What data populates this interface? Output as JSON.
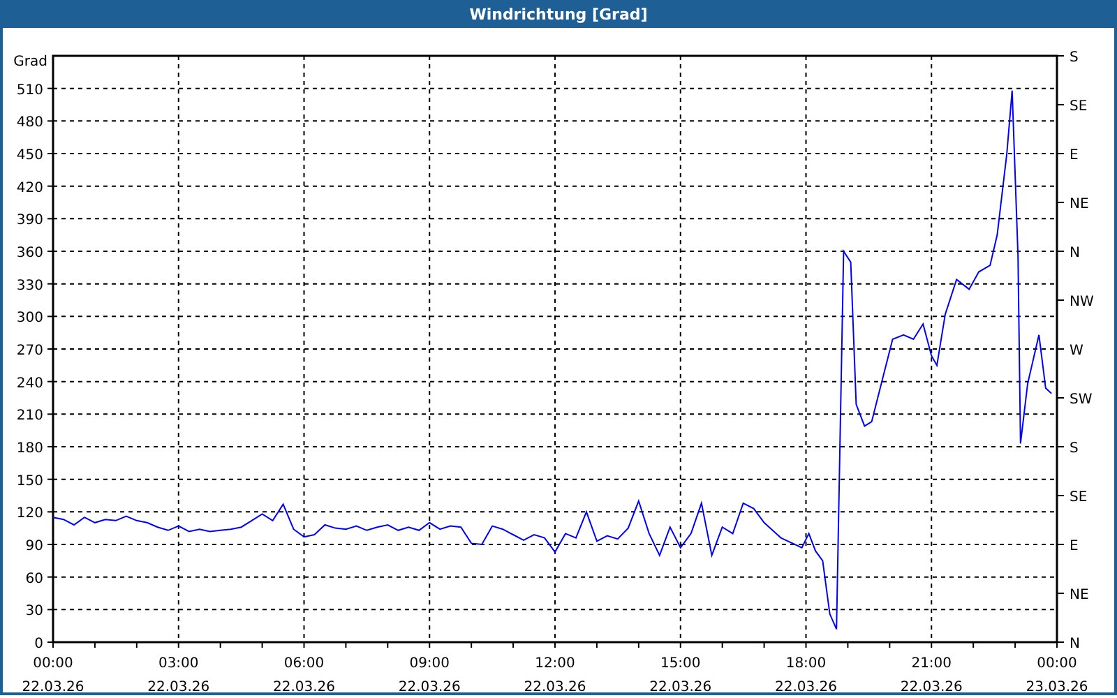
{
  "window": {
    "title": "Windrichtung [Grad]"
  },
  "chart": {
    "chart_data": {
      "type": "line",
      "grid": true,
      "ylabel": "Grad",
      "xlim": [
        0,
        24
      ],
      "ylim": [
        0,
        540
      ],
      "xticks": [
        {
          "value": 0,
          "label": "00:00"
        },
        {
          "value": 3,
          "label": "03:00"
        },
        {
          "value": 6,
          "label": "06:00"
        },
        {
          "value": 9,
          "label": "09:00"
        },
        {
          "value": 12,
          "label": "12:00"
        },
        {
          "value": 15,
          "label": "15:00"
        },
        {
          "value": 18,
          "label": "18:00"
        },
        {
          "value": 21,
          "label": "21:00"
        },
        {
          "value": 24,
          "label": "00:00"
        }
      ],
      "yticks": [
        0,
        30,
        60,
        90,
        120,
        150,
        180,
        210,
        240,
        270,
        300,
        330,
        360,
        390,
        420,
        450,
        480,
        510
      ],
      "x": [
        0,
        0.25,
        0.5,
        0.75,
        1,
        1.25,
        1.5,
        1.75,
        2,
        2.25,
        2.5,
        2.75,
        3,
        3.25,
        3.5,
        3.75,
        4,
        4.25,
        4.5,
        4.75,
        5,
        5.25,
        5.5,
        5.75,
        6,
        6.25,
        6.5,
        6.75,
        7,
        7.25,
        7.5,
        7.75,
        8,
        8.25,
        8.5,
        8.75,
        9,
        9.25,
        9.5,
        9.75,
        10,
        10.25,
        10.5,
        10.75,
        11,
        11.25,
        11.5,
        11.75,
        12,
        12.25,
        12.5,
        12.75,
        13,
        13.25,
        13.5,
        13.75,
        14,
        14.25,
        14.5,
        14.75,
        15,
        15.25,
        15.5,
        15.75,
        16,
        16.25,
        16.5,
        16.75,
        17,
        17.4,
        17.9,
        18.07,
        18.23,
        18.4,
        18.57,
        18.73,
        18.9,
        19.07,
        19.2,
        19.4,
        19.57,
        19.8,
        20.07,
        20.33,
        20.57,
        20.8,
        21.0,
        21.13,
        21.33,
        21.6,
        21.9,
        22.13,
        22.4,
        22.57,
        22.8,
        22.93,
        23.07,
        23.13,
        23.3,
        23.57,
        23.73,
        23.87
      ],
      "series": [
        {
          "color": "#0000ff",
          "values": [
            115,
            113,
            108,
            115,
            110,
            113,
            112,
            116,
            112,
            110,
            106,
            103,
            107,
            102,
            104,
            102,
            103,
            104,
            106,
            112,
            118,
            112,
            127,
            104,
            97,
            99,
            108,
            105,
            104,
            107,
            103,
            106,
            108,
            103,
            106,
            103,
            110,
            104,
            107,
            106,
            91,
            90,
            107,
            104,
            99,
            94,
            99,
            96,
            83,
            100,
            96,
            120,
            93,
            98,
            95,
            105,
            130,
            100,
            80,
            106,
            87,
            100,
            128,
            80,
            106,
            100,
            128,
            123,
            110,
            96,
            87,
            100,
            84,
            75,
            26,
            12,
            360,
            350,
            219,
            199,
            203,
            238,
            279,
            283,
            279,
            293,
            264,
            255,
            302,
            334,
            325,
            341,
            347,
            375,
            450,
            508,
            356,
            183,
            238,
            283,
            234,
            229
          ]
        }
      ]
    },
    "date_labels": [
      "22.03.26",
      "22.03.26",
      "22.03.26",
      "22.03.26",
      "22.03.26",
      "22.03.26",
      "22.03.26",
      "22.03.26",
      "23.03.26"
    ],
    "direction_labels": [
      "S",
      "SE",
      "E",
      "NE",
      "N",
      "NW",
      "W",
      "SW",
      "S",
      "SE",
      "E",
      "NE",
      "N"
    ]
  }
}
